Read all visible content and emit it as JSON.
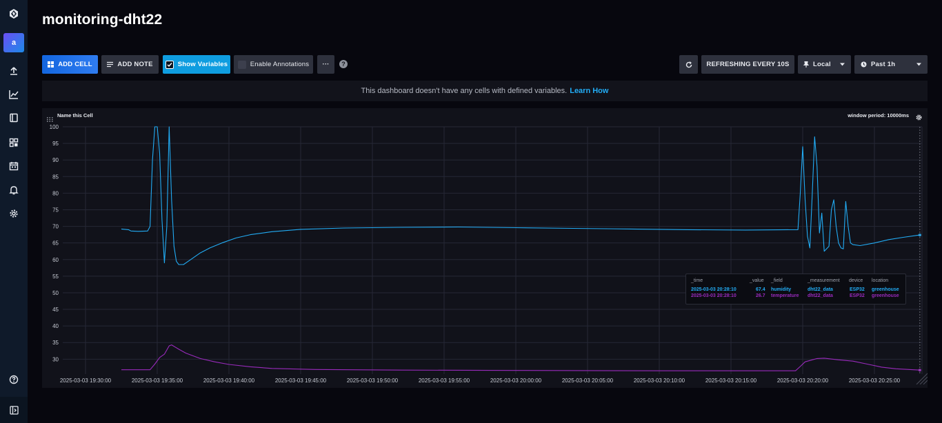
{
  "sidebar": {
    "avatar_letter": "a",
    "items": [
      {
        "icon": "logo-icon"
      },
      {
        "icon": "upload-icon"
      },
      {
        "icon": "graph-icon"
      },
      {
        "icon": "book-icon"
      },
      {
        "icon": "dashboards-icon"
      },
      {
        "icon": "calendar-icon"
      },
      {
        "icon": "bell-icon"
      },
      {
        "icon": "gear-icon"
      },
      {
        "icon": "help-icon"
      },
      {
        "icon": "collapse-icon"
      }
    ]
  },
  "dashboard": {
    "title": "monitoring-dht22"
  },
  "toolbar": {
    "add_cell": "ADD CELL",
    "add_note": "ADD NOTE",
    "show_variables": "Show Variables",
    "enable_annotations": "Enable Annotations",
    "more": "···",
    "help": "?",
    "refresh_label": "REFRESHING EVERY 10S",
    "timezone": "Local",
    "time_range": "Past 1h"
  },
  "banner": {
    "text": "This dashboard doesn't have any cells with defined variables.",
    "link": "Learn How"
  },
  "cell": {
    "title": "Name this Cell",
    "window_period": "window period: 10000ms"
  },
  "tooltip": {
    "headers": {
      "time": "_time",
      "value": "_value",
      "field": "_field",
      "measurement": "_measurement",
      "device": "device",
      "location": "location"
    },
    "rows": [
      {
        "time": "2025-03-03 20:28:10",
        "value": "67.4",
        "field": "humidity",
        "measurement": "dht22_data",
        "device": "ESP32",
        "location": "greenhouse"
      },
      {
        "time": "2025-03-03 20:28:10",
        "value": "26.7",
        "field": "temperature",
        "measurement": "dht22_data",
        "device": "ESP32",
        "location": "greenhouse"
      }
    ]
  },
  "chart_data": {
    "type": "line",
    "title": "Name this Cell",
    "xlabel": "",
    "ylabel": "",
    "ylim": [
      25.5,
      100
    ],
    "yticks": [
      30,
      35,
      40,
      45,
      50,
      55,
      60,
      65,
      70,
      75,
      80,
      85,
      90,
      95,
      100
    ],
    "x_ticks": [
      "2025-03-03 19:30:00",
      "2025-03-03 19:35:00",
      "2025-03-03 19:40:00",
      "2025-03-03 19:45:00",
      "2025-03-03 19:50:00",
      "2025-03-03 19:55:00",
      "2025-03-03 20:00:00",
      "2025-03-03 20:05:00",
      "2025-03-03 20:10:00",
      "2025-03-03 20:15:00",
      "2025-03-03 20:20:00",
      "2025-03-03 20:25:00"
    ],
    "grid": true,
    "colors": {
      "humidity": "#22adf6",
      "temperature": "#9a2bbd",
      "grid": "#262836"
    },
    "series": [
      {
        "name": "humidity",
        "points": [
          [
            "2025-03-03 19:32:30",
            69.2
          ],
          [
            "2025-03-03 19:33:00",
            69.0
          ],
          [
            "2025-03-03 19:33:10",
            68.6
          ],
          [
            "2025-03-03 19:33:40",
            68.5
          ],
          [
            "2025-03-03 19:34:20",
            68.6
          ],
          [
            "2025-03-03 19:34:30",
            70.0
          ],
          [
            "2025-03-03 19:34:40",
            90.0
          ],
          [
            "2025-03-03 19:34:50",
            100.0
          ],
          [
            "2025-03-03 19:35:00",
            100.0
          ],
          [
            "2025-03-03 19:35:10",
            92.0
          ],
          [
            "2025-03-03 19:35:20",
            72.0
          ],
          [
            "2025-03-03 19:35:30",
            59.0
          ],
          [
            "2025-03-03 19:35:40",
            70.0
          ],
          [
            "2025-03-03 19:35:50",
            100.0
          ],
          [
            "2025-03-03 19:36:00",
            78.0
          ],
          [
            "2025-03-03 19:36:10",
            64.0
          ],
          [
            "2025-03-03 19:36:20",
            59.5
          ],
          [
            "2025-03-03 19:36:30",
            58.5
          ],
          [
            "2025-03-03 19:36:50",
            58.5
          ],
          [
            "2025-03-03 19:37:20",
            60.0
          ],
          [
            "2025-03-03 19:38:00",
            62.0
          ],
          [
            "2025-03-03 19:38:40",
            63.5
          ],
          [
            "2025-03-03 19:39:30",
            65.0
          ],
          [
            "2025-03-03 19:40:30",
            66.5
          ],
          [
            "2025-03-03 19:41:30",
            67.5
          ],
          [
            "2025-03-03 19:43:00",
            68.4
          ],
          [
            "2025-03-03 19:45:00",
            69.1
          ],
          [
            "2025-03-03 19:48:00",
            69.5
          ],
          [
            "2025-03-03 19:52:00",
            69.7
          ],
          [
            "2025-03-03 19:56:00",
            69.8
          ],
          [
            "2025-03-03 20:00:00",
            69.6
          ],
          [
            "2025-03-03 20:04:00",
            69.4
          ],
          [
            "2025-03-03 20:08:00",
            69.2
          ],
          [
            "2025-03-03 20:12:00",
            69.0
          ],
          [
            "2025-03-03 20:16:00",
            68.9
          ],
          [
            "2025-03-03 20:19:40",
            69.0
          ],
          [
            "2025-03-03 20:19:50",
            80.0
          ],
          [
            "2025-03-03 20:20:00",
            94.0
          ],
          [
            "2025-03-03 20:20:10",
            78.0
          ],
          [
            "2025-03-03 20:20:20",
            67.0
          ],
          [
            "2025-03-03 20:20:30",
            63.5
          ],
          [
            "2025-03-03 20:20:40",
            80.0
          ],
          [
            "2025-03-03 20:20:50",
            97.0
          ],
          [
            "2025-03-03 20:21:00",
            88.0
          ],
          [
            "2025-03-03 20:21:10",
            68.0
          ],
          [
            "2025-03-03 20:21:20",
            74.0
          ],
          [
            "2025-03-03 20:21:30",
            62.5
          ],
          [
            "2025-03-03 20:21:50",
            64.0
          ],
          [
            "2025-03-03 20:22:00",
            75.0
          ],
          [
            "2025-03-03 20:22:10",
            78.0
          ],
          [
            "2025-03-03 20:22:20",
            70.0
          ],
          [
            "2025-03-03 20:22:30",
            65.0
          ],
          [
            "2025-03-03 20:22:40",
            63.5
          ],
          [
            "2025-03-03 20:22:50",
            63.2
          ],
          [
            "2025-03-03 20:23:00",
            77.5
          ],
          [
            "2025-03-03 20:23:10",
            70.0
          ],
          [
            "2025-03-03 20:23:20",
            65.0
          ],
          [
            "2025-03-03 20:23:30",
            64.5
          ],
          [
            "2025-03-03 20:24:00",
            64.2
          ],
          [
            "2025-03-03 20:25:00",
            65.0
          ],
          [
            "2025-03-03 20:26:00",
            66.0
          ],
          [
            "2025-03-03 20:27:00",
            66.7
          ],
          [
            "2025-03-03 20:28:10",
            67.4
          ]
        ]
      },
      {
        "name": "temperature",
        "points": [
          [
            "2025-03-03 19:32:30",
            26.8
          ],
          [
            "2025-03-03 19:34:30",
            26.8
          ],
          [
            "2025-03-03 19:34:50",
            28.5
          ],
          [
            "2025-03-03 19:35:10",
            30.5
          ],
          [
            "2025-03-03 19:35:30",
            31.5
          ],
          [
            "2025-03-03 19:35:50",
            34.0
          ],
          [
            "2025-03-03 19:36:00",
            34.3
          ],
          [
            "2025-03-03 19:36:30",
            33.0
          ],
          [
            "2025-03-03 19:37:00",
            31.8
          ],
          [
            "2025-03-03 19:38:00",
            30.2
          ],
          [
            "2025-03-03 19:39:00",
            29.2
          ],
          [
            "2025-03-03 19:40:00",
            28.4
          ],
          [
            "2025-03-03 19:41:30",
            27.7
          ],
          [
            "2025-03-03 19:43:00",
            27.2
          ],
          [
            "2025-03-03 19:46:00",
            26.9
          ],
          [
            "2025-03-03 19:52:00",
            26.7
          ],
          [
            "2025-03-03 20:00:00",
            26.6
          ],
          [
            "2025-03-03 20:10:00",
            26.5
          ],
          [
            "2025-03-03 20:19:30",
            26.5
          ],
          [
            "2025-03-03 20:19:50",
            27.8
          ],
          [
            "2025-03-03 20:20:10",
            29.2
          ],
          [
            "2025-03-03 20:20:40",
            29.8
          ],
          [
            "2025-03-03 20:21:00",
            30.2
          ],
          [
            "2025-03-03 20:21:30",
            30.3
          ],
          [
            "2025-03-03 20:22:30",
            29.8
          ],
          [
            "2025-03-03 20:23:30",
            29.4
          ],
          [
            "2025-03-03 20:24:30",
            28.5
          ],
          [
            "2025-03-03 20:25:30",
            27.6
          ],
          [
            "2025-03-03 20:26:30",
            27.1
          ],
          [
            "2025-03-03 20:28:10",
            26.7
          ]
        ]
      }
    ]
  }
}
